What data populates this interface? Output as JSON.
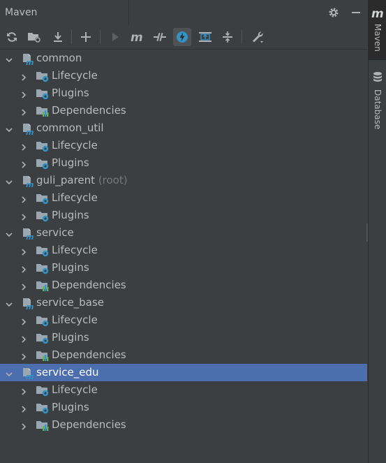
{
  "window": {
    "title": "Maven"
  },
  "toolbar": {
    "items": [
      {
        "name": "reload-icon"
      },
      {
        "name": "add-folder-icon"
      },
      {
        "name": "download-icon"
      },
      {
        "name": "plus-icon"
      },
      {
        "name": "run-icon"
      },
      {
        "name": "maven-goal-icon"
      },
      {
        "name": "toggle-offline-icon"
      },
      {
        "name": "skip-tests-icon"
      },
      {
        "name": "show-dependencies-icon"
      },
      {
        "name": "collapse-all-icon"
      },
      {
        "name": "settings-wrench-icon"
      }
    ]
  },
  "tree": {
    "projects": [
      {
        "name": "common",
        "suffix": "",
        "children": [
          "Lifecycle",
          "Plugins",
          "Dependencies"
        ]
      },
      {
        "name": "common_util",
        "suffix": "",
        "children": [
          "Lifecycle",
          "Plugins"
        ]
      },
      {
        "name": "guli_parent",
        "suffix": "(root)",
        "children": [
          "Lifecycle",
          "Plugins"
        ]
      },
      {
        "name": "service",
        "suffix": "",
        "children": [
          "Lifecycle",
          "Plugins",
          "Dependencies"
        ]
      },
      {
        "name": "service_base",
        "suffix": "",
        "children": [
          "Lifecycle",
          "Plugins",
          "Dependencies"
        ]
      },
      {
        "name": "service_edu",
        "suffix": "",
        "children": [
          "Lifecycle",
          "Plugins",
          "Dependencies"
        ]
      }
    ],
    "selected": "service_edu"
  },
  "stripe": {
    "tabs": [
      {
        "label": "Maven",
        "icon": "maven-m-icon"
      },
      {
        "label": "Database",
        "icon": "database-icon"
      }
    ]
  },
  "colors": {
    "background": "#3c3f41",
    "selection": "#4b6eaf",
    "text": "#bbbbbb",
    "muted": "#787878",
    "accent_blue": "#3592c4"
  }
}
